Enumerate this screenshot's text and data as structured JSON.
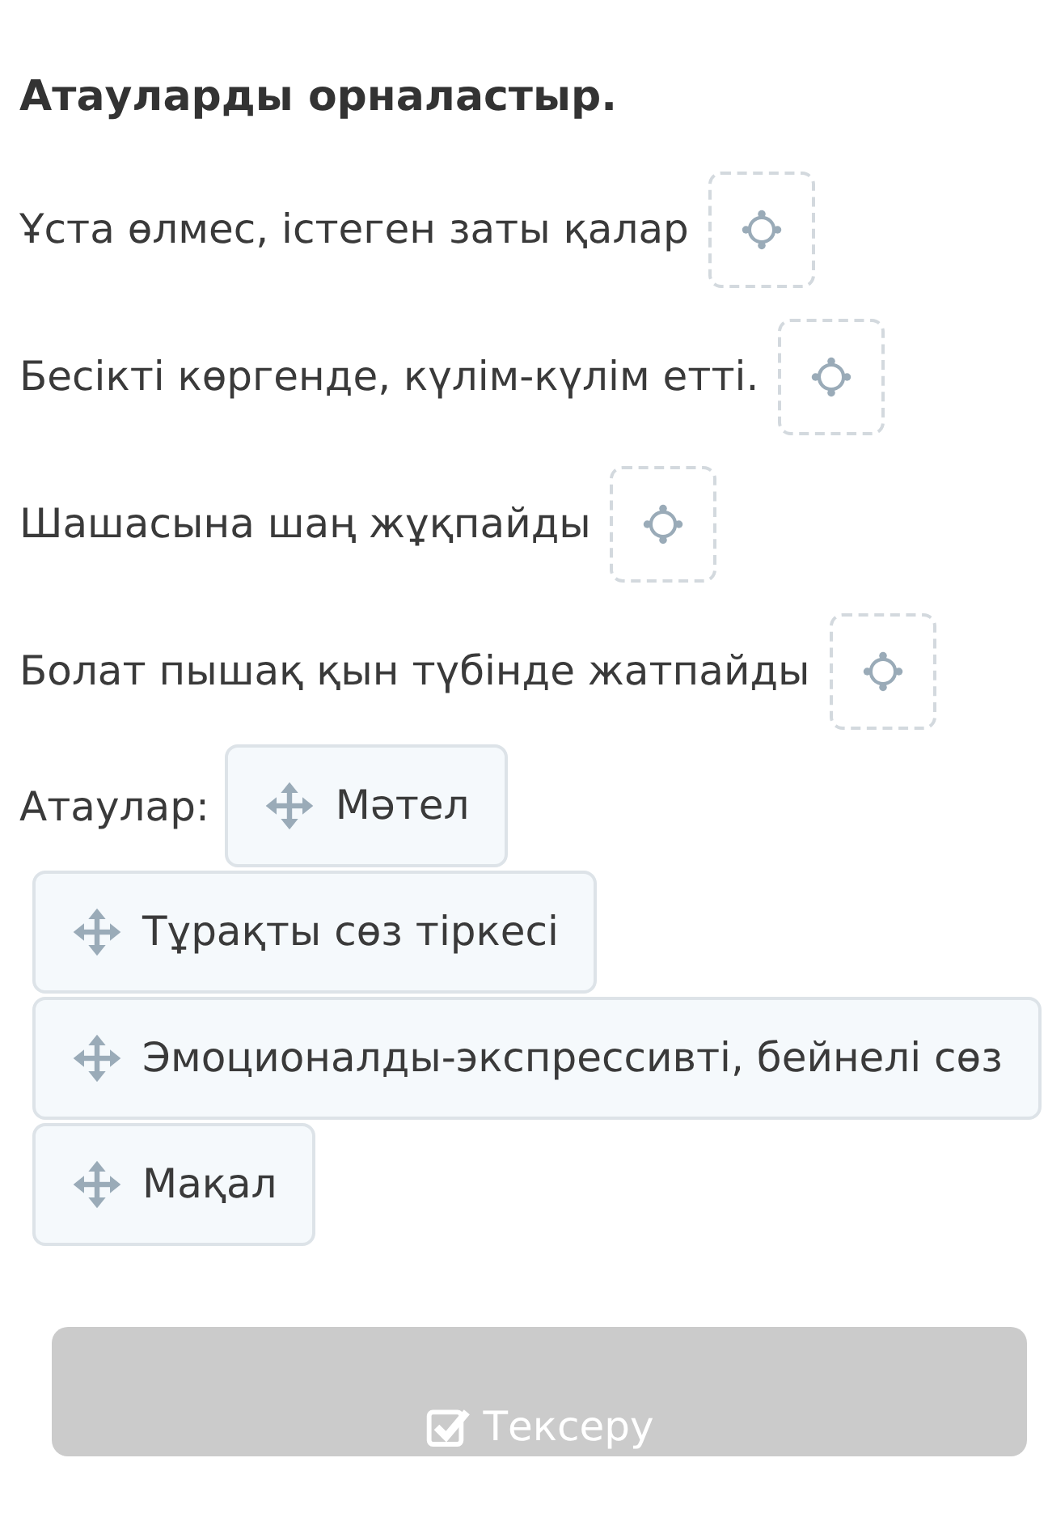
{
  "title": "Атауларды орналастыр.",
  "items": [
    {
      "text": "Ұста өлмес, істеген заты қалар"
    },
    {
      "text": "Бесікті көргенде, күлім-күлім етті."
    },
    {
      "text": "Шашасына шаң жұқпайды"
    },
    {
      "text": "Болат пышақ қын түбінде жатпайды"
    }
  ],
  "options_label": "Атаулар:",
  "options": [
    "Мәтел",
    "Тұрақты сөз тіркесі",
    "Эмоционалды-экспрессивті, бейнелі сөз",
    "Мақал"
  ],
  "check_button": "Тексеру"
}
